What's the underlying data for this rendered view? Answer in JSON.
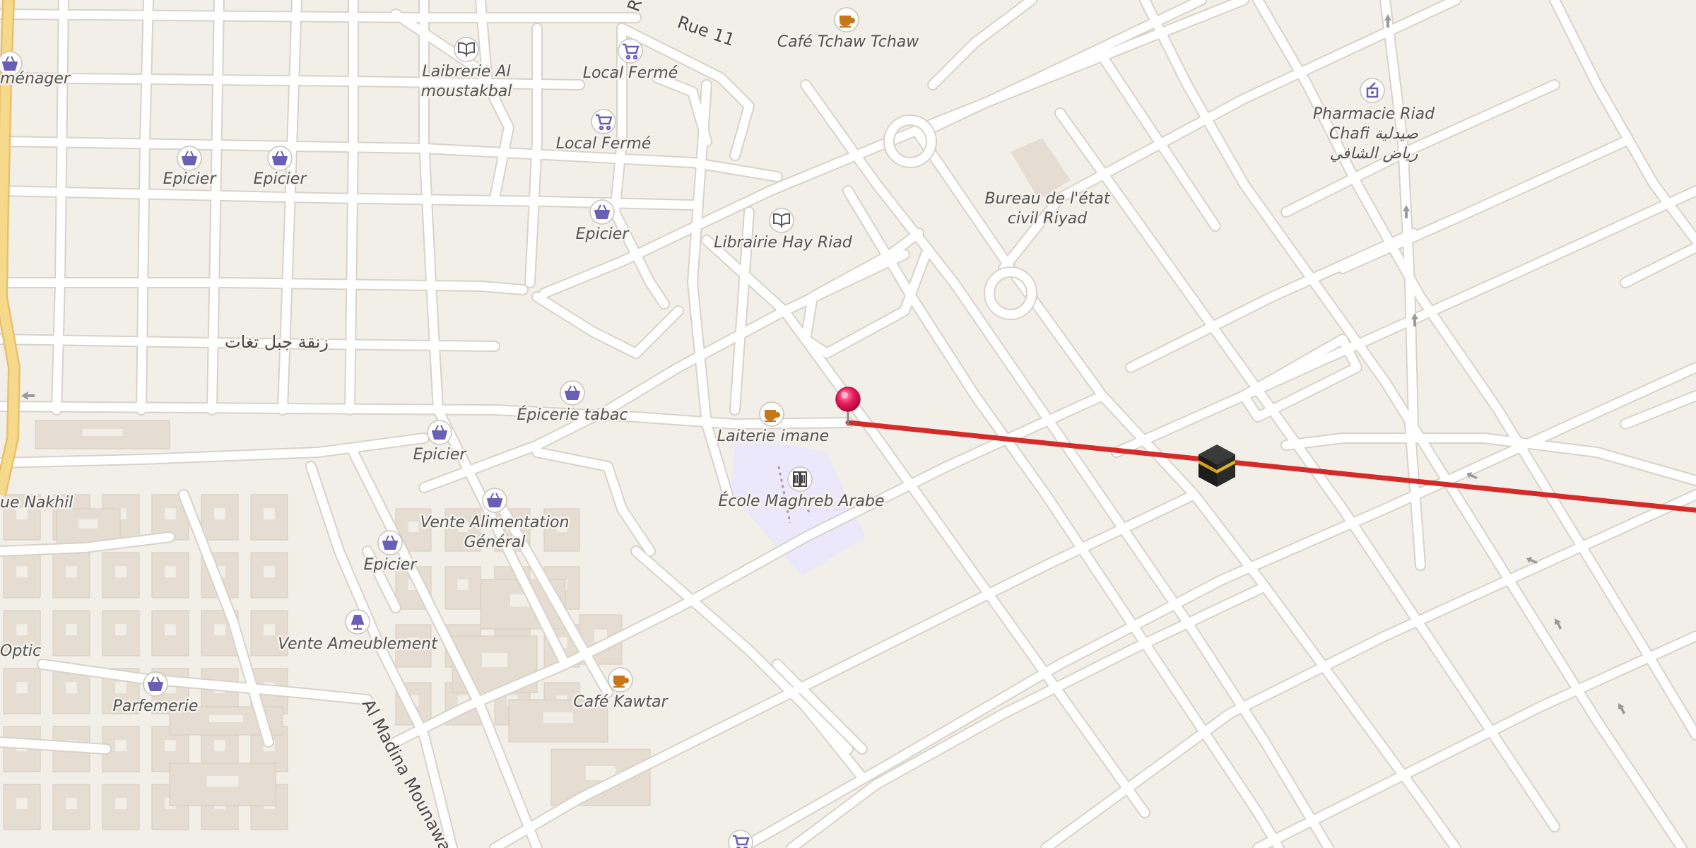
{
  "map": {
    "colors": {
      "background": "#f2efe9",
      "road": "#ffffff",
      "road_casing": "#d8d2c8",
      "major_road": "#f7d98b",
      "building": "#e6ddd2",
      "school_area": "#ece8fb",
      "route_line": "#d42a2a",
      "pin": "#e8185a",
      "poi_shop": "#6a5fb7",
      "poi_cafe": "#c7761a"
    },
    "street_labels": {
      "rue11": "Rue 11",
      "rue_r": "R",
      "arabic_street": "زنقة جبل تغات",
      "madina": "Al Madina Mounawa"
    },
    "pois": [
      {
        "name": "poi-menager",
        "icon": "basket-icon",
        "lines": [
          "ménager"
        ]
      },
      {
        "name": "poi-laibrerie",
        "icon": "book-icon",
        "lines": [
          "Laibrerie Al",
          "moustakbal"
        ]
      },
      {
        "name": "poi-local-ferme-1",
        "icon": "cart-icon",
        "lines": [
          "Local Fermé"
        ]
      },
      {
        "name": "poi-local-ferme-2",
        "icon": "cart-icon",
        "lines": [
          "Local Fermé"
        ]
      },
      {
        "name": "poi-cafe-tchaw",
        "icon": "cafe-icon",
        "lines": [
          "Café Tchaw Tchaw"
        ]
      },
      {
        "name": "poi-pharmacie",
        "icon": "pharmacy-icon",
        "lines": [
          "Pharmacie Riad",
          "Chafi صيدلية",
          "رياض الشافي"
        ]
      },
      {
        "name": "poi-epicier-1",
        "icon": "basket-icon",
        "lines": [
          "Epicier"
        ]
      },
      {
        "name": "poi-epicier-2",
        "icon": "basket-icon",
        "lines": [
          "Epicier"
        ]
      },
      {
        "name": "poi-epicier-3",
        "icon": "basket-icon",
        "lines": [
          "Epicier"
        ]
      },
      {
        "name": "poi-bureau-etat",
        "icon": "",
        "lines": [
          "Bureau de l'état",
          "civil Riyad"
        ]
      },
      {
        "name": "poi-librairie-hay-riad",
        "icon": "book-icon",
        "lines": [
          "Librairie Hay Riad"
        ]
      },
      {
        "name": "poi-epicerie-tabac",
        "icon": "basket-icon",
        "lines": [
          "Épicerie tabac"
        ]
      },
      {
        "name": "poi-laiterie",
        "icon": "cafe-icon",
        "lines": [
          "Laiterie imane"
        ]
      },
      {
        "name": "poi-epicier-4",
        "icon": "basket-icon",
        "lines": [
          "Epicier"
        ]
      },
      {
        "name": "poi-ecole",
        "icon": "school-icon",
        "lines": [
          "École Maghreb Arabe"
        ]
      },
      {
        "name": "poi-nakhil",
        "icon": "",
        "lines": [
          "ue Nakhil"
        ]
      },
      {
        "name": "poi-vente-alimentation",
        "icon": "basket-icon",
        "lines": [
          "Vente Alimentation",
          "Général"
        ]
      },
      {
        "name": "poi-epicier-5",
        "icon": "basket-icon",
        "lines": [
          "Epicier"
        ]
      },
      {
        "name": "poi-vente-ameublement",
        "icon": "lamp-icon",
        "lines": [
          "Vente Ameublement"
        ]
      },
      {
        "name": "poi-optic",
        "icon": "",
        "lines": [
          "Optic"
        ]
      },
      {
        "name": "poi-parfemerie",
        "icon": "basket-icon",
        "lines": [
          "Parfemerie"
        ]
      },
      {
        "name": "poi-cafe-kawtar",
        "icon": "cafe-icon",
        "lines": [
          "Café Kawtar"
        ]
      },
      {
        "name": "poi-cart-bottom",
        "icon": "cart-icon",
        "lines": []
      }
    ],
    "markers": {
      "pin": "location-pin-icon",
      "destination": "kaaba-icon"
    }
  }
}
